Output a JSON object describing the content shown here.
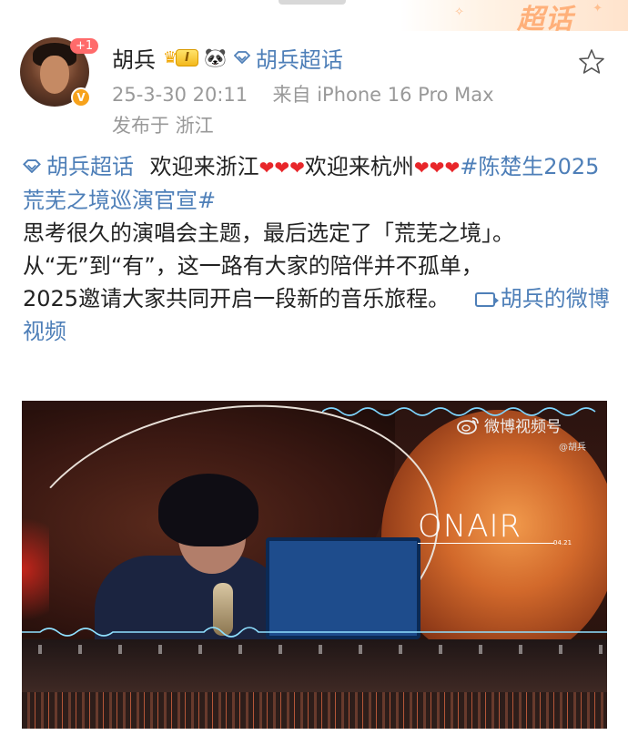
{
  "header": {
    "chaohua_label": "超话"
  },
  "author": {
    "avatar_badge": "+1",
    "name": "胡兵",
    "level": "I",
    "topic": "胡兵超话",
    "timestamp": "25-3-30 20:11",
    "source": "来自 iPhone 16 Pro Max",
    "location": "发布于 浙江"
  },
  "post": {
    "topic_link": "胡兵超话",
    "text_welcome_zj": "欢迎来浙江",
    "hearts_1": "❤❤❤",
    "text_welcome_hz": "欢迎来杭州",
    "hearts_2": "❤❤❤",
    "hashtag": "#陈楚生2025荒芜之境巡演官宣#",
    "line_theme": "思考很久的演唱会主题，最后选定了「荒芜之境」。",
    "line_journey": "从“无”到“有”，这一路有大家的陪伴并不孤单，",
    "line_invite": "2025邀请大家共同开启一段新的音乐旅程。",
    "video_link": "胡兵的微博视频"
  },
  "video": {
    "watermark": "微博视频号",
    "watermark_sub": "@胡兵",
    "onair_text": "ONAIR",
    "onair_sub": "04.21"
  },
  "colors": {
    "link": "#4e7fb8",
    "heart": "#e8262a",
    "meta": "#999999"
  }
}
